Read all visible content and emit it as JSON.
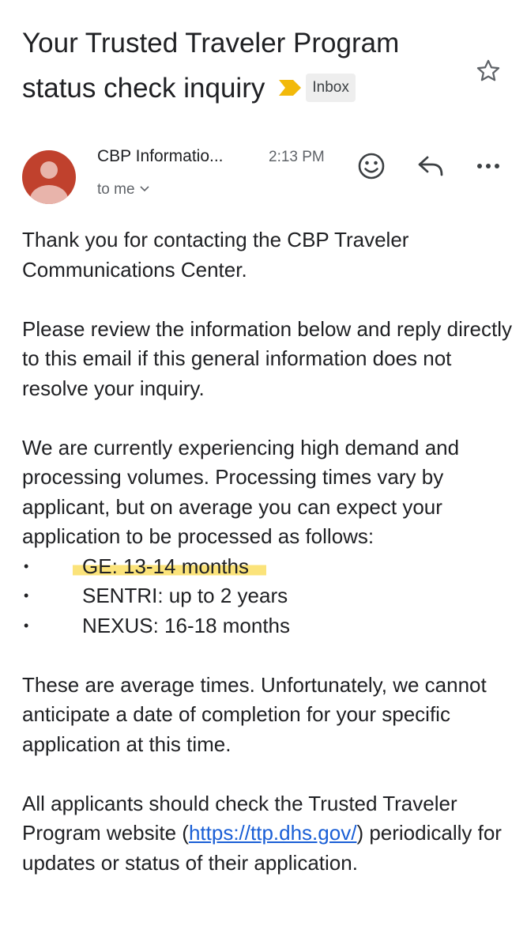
{
  "email": {
    "subject": "Your Trusted Traveler Program status check inquiry",
    "label": "Inbox",
    "sender": "CBP Informatio...",
    "time": "2:13 PM",
    "recipient": "to me",
    "icons": {
      "importance": "importance-marker-icon",
      "star": "star-icon",
      "emoji": "emoji-reaction-icon",
      "reply": "reply-icon",
      "more": "more-options-icon",
      "chevron": "chevron-down-icon"
    },
    "colors": {
      "avatar": "#c0412d",
      "importance": "#f2b90a",
      "highlight": "#fbe37a",
      "link": "#1a5fd6"
    }
  },
  "body": {
    "p1": "Thank you for contacting the CBP Traveler Communications Center.",
    "p2": "Please review the information below and reply directly to this email if this general information does not resolve your inquiry.",
    "p3": "We are currently experiencing high demand and processing volumes. Processing times vary by applicant, but on average you can expect your application to be processed as follows:",
    "bullet_glyph": "•",
    "bullets": [
      "GE: 13-14 months",
      "SENTRI: up to 2 years",
      "NEXUS: 16-18 months"
    ],
    "p4": "These are average times. Unfortunately, we cannot anticipate a date of completion for your specific application at this time.",
    "p5_before": "All applicants should check the Trusted Traveler Program website (",
    "p5_link": "https://ttp.dhs.gov/",
    "p5_after": ") periodically for updates or status of their application."
  }
}
